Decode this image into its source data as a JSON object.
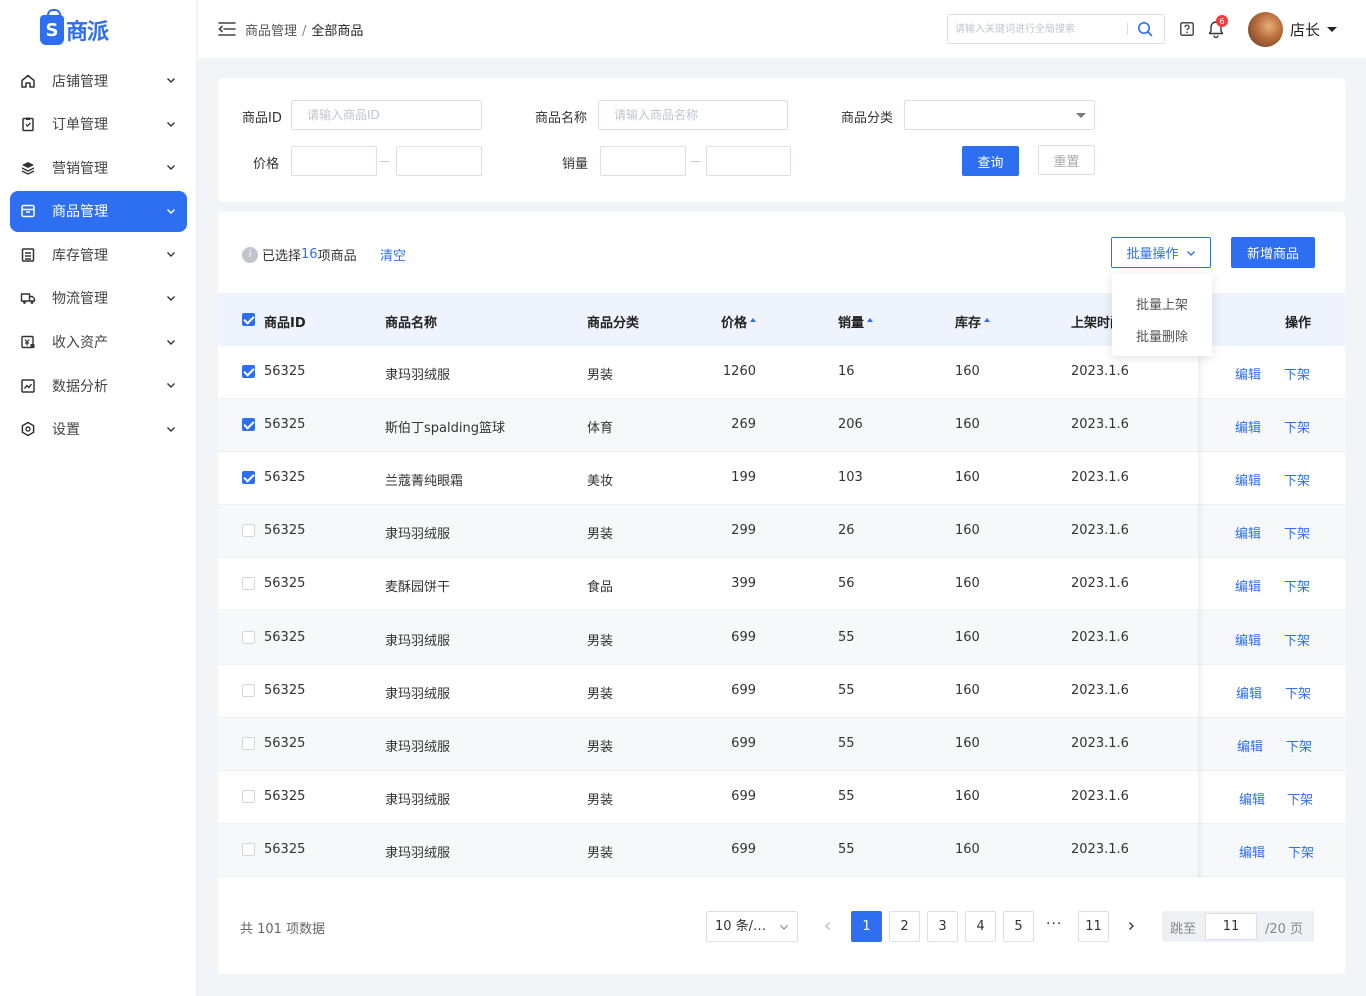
{
  "brand": {
    "name": "商派",
    "mark": "S",
    "color": "#2d6ff0"
  },
  "sidebar": {
    "items": [
      {
        "label": "店铺管理",
        "icon": "home-icon",
        "active": false
      },
      {
        "label": "订单管理",
        "icon": "clipboard-icon",
        "active": false
      },
      {
        "label": "营销管理",
        "icon": "layers-icon",
        "active": false
      },
      {
        "label": "商品管理",
        "icon": "box-icon",
        "active": true
      },
      {
        "label": "库存管理",
        "icon": "inventory-icon",
        "active": false
      },
      {
        "label": "物流管理",
        "icon": "truck-icon",
        "active": false
      },
      {
        "label": "收入资产",
        "icon": "wallet-icon",
        "active": false
      },
      {
        "label": "数据分析",
        "icon": "chart-icon",
        "active": false
      },
      {
        "label": "设置",
        "icon": "settings-icon",
        "active": false
      }
    ]
  },
  "header": {
    "breadcrumb_parent": "商品管理",
    "breadcrumb_sep": "/",
    "breadcrumb_current": "全部商品",
    "search_placeholder": "请输入关键词进行全局搜索",
    "notification_count": "6",
    "user_name": "店长"
  },
  "filters": {
    "product_id_label": "商品ID",
    "product_id_placeholder": "请输入商品ID",
    "product_name_label": "商品名称",
    "product_name_placeholder": "请输入商品名称",
    "category_label": "商品分类",
    "category_value": "",
    "price_label": "价格",
    "sales_label": "销量",
    "query_label": "查询",
    "reset_label": "重置"
  },
  "toolbar": {
    "selected_prefix": "已选择",
    "selected_count": "16",
    "selected_suffix": "项商品",
    "clear_label": "清空",
    "bulk_label": "批量操作",
    "new_label": "新增商品",
    "bulk_menu": [
      "批量上架",
      "批量删除"
    ]
  },
  "table": {
    "columns": {
      "id": "商品ID",
      "name": "商品名称",
      "category": "商品分类",
      "price": "价格",
      "sales": "销量",
      "stock": "库存",
      "listed": "上架时间",
      "actions": "操作"
    },
    "edit_label": "编辑",
    "off_label": "下架",
    "rows": [
      {
        "checked": true,
        "id": "56325",
        "name": "隶玛羽绒服",
        "category": "男装",
        "price": "1260",
        "sales": "16",
        "stock": "160",
        "date": "2023.1.6"
      },
      {
        "checked": true,
        "id": "56325",
        "name": "斯伯丁spalding篮球",
        "category": "体育",
        "price": "269",
        "sales": "206",
        "stock": "160",
        "date": "2023.1.6"
      },
      {
        "checked": true,
        "id": "56325",
        "name": "兰蔻菁纯眼霜",
        "category": "美妆",
        "price": "199",
        "sales": "103",
        "stock": "160",
        "date": "2023.1.6"
      },
      {
        "checked": false,
        "id": "56325",
        "name": "隶玛羽绒服",
        "category": "男装",
        "price": "299",
        "sales": "26",
        "stock": "160",
        "date": "2023.1.6"
      },
      {
        "checked": false,
        "id": "56325",
        "name": "麦酥园饼干",
        "category": "食品",
        "price": "399",
        "sales": "56",
        "stock": "160",
        "date": "2023.1.6"
      },
      {
        "checked": false,
        "id": "56325",
        "name": "隶玛羽绒服",
        "category": "男装",
        "price": "699",
        "sales": "55",
        "stock": "160",
        "date": "2023.1.6"
      },
      {
        "checked": false,
        "id": "56325",
        "name": "隶玛羽绒服",
        "category": "男装",
        "price": "699",
        "sales": "55",
        "stock": "160",
        "date": "2023.1.6"
      },
      {
        "checked": false,
        "id": "56325",
        "name": "隶玛羽绒服",
        "category": "男装",
        "price": "699",
        "sales": "55",
        "stock": "160",
        "date": "2023.1.6"
      },
      {
        "checked": false,
        "id": "56325",
        "name": "隶玛羽绒服",
        "category": "男装",
        "price": "699",
        "sales": "55",
        "stock": "160",
        "date": "2023.1.6"
      },
      {
        "checked": false,
        "id": "56325",
        "name": "隶玛羽绒服",
        "category": "男装",
        "price": "699",
        "sales": "55",
        "stock": "160",
        "date": "2023.1.6"
      }
    ]
  },
  "pagination": {
    "total_text": "共 101 项数据",
    "page_size": "10 条/…",
    "pages": [
      "1",
      "2",
      "3",
      "4",
      "5"
    ],
    "ellipsis": "···",
    "last_page": "11",
    "current_page": "1",
    "jump_label": "跳至",
    "jump_value": "11",
    "jump_total": "/20 页"
  }
}
